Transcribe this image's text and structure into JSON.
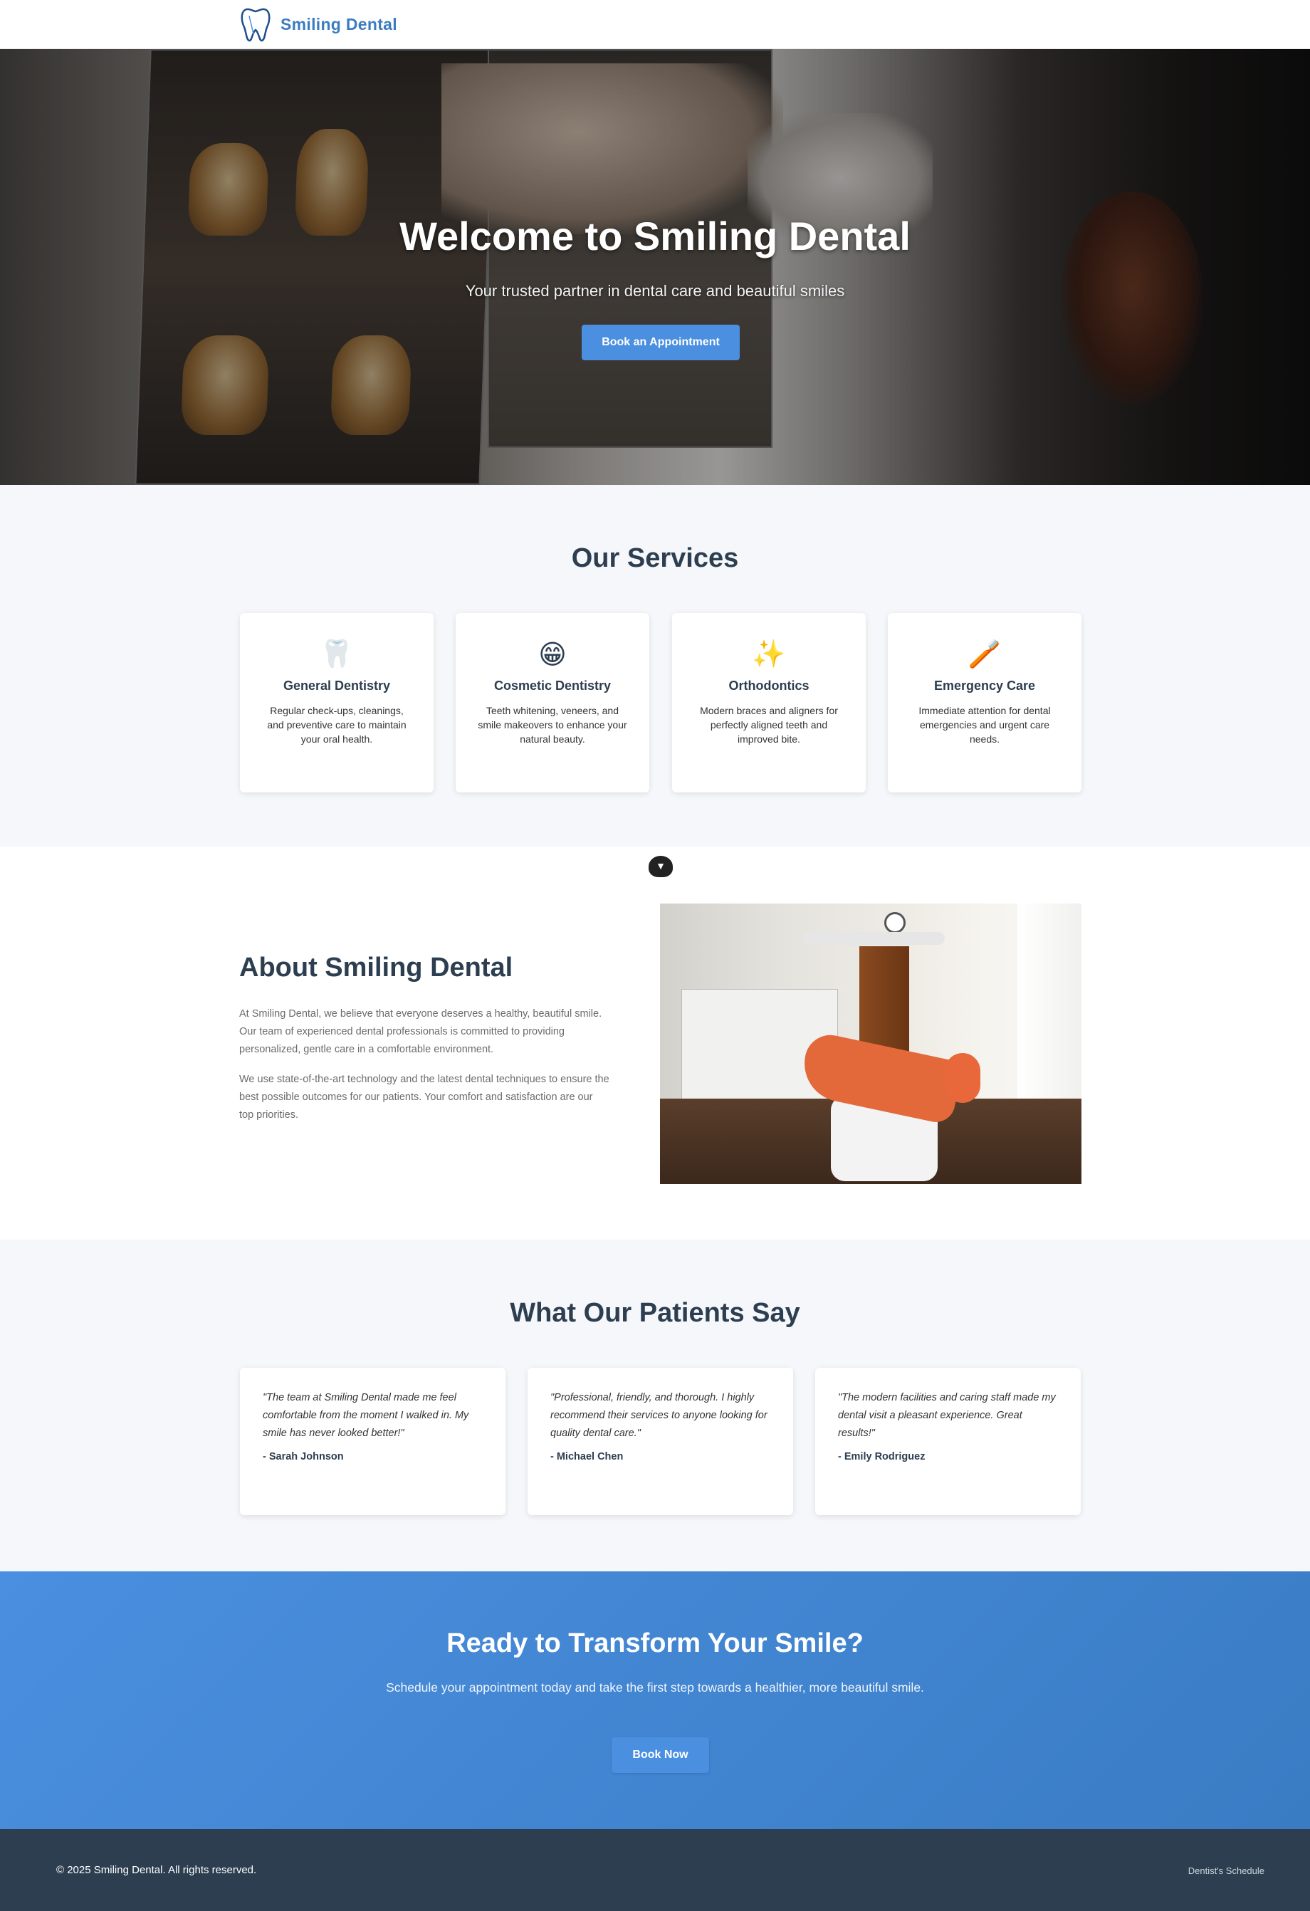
{
  "brand": {
    "name": "Smiling Dental",
    "accent": "#4a8fe0",
    "dark": "#2c3e50"
  },
  "hero": {
    "title": "Welcome to Smiling Dental",
    "subtitle": "Your trusted partner in dental care and beautiful smiles",
    "cta_label": "Book an Appointment"
  },
  "services": {
    "title": "Our Services",
    "items": [
      {
        "icon": "tooth-icon",
        "glyph": "🦷",
        "title": "General Dentistry",
        "desc": "Regular check-ups, cleanings, and preventive care to maintain your oral health."
      },
      {
        "icon": "grin-icon",
        "glyph": "😁",
        "title": "Cosmetic Dentistry",
        "desc": "Teeth whitening, veneers, and smile makeovers to enhance your natural beauty."
      },
      {
        "icon": "sparkles-icon",
        "glyph": "✨",
        "title": "Orthodontics",
        "desc": "Modern braces and aligners for perfectly aligned teeth and improved bite."
      },
      {
        "icon": "toothbrush-icon",
        "glyph": "🪥",
        "title": "Emergency Care",
        "desc": "Immediate attention for dental emergencies and urgent care needs."
      }
    ]
  },
  "about": {
    "title": "About Smiling Dental",
    "p1": "At Smiling Dental, we believe that everyone deserves a healthy, beautiful smile. Our team of experienced dental professionals is committed to providing personalized, gentle care in a comfortable environment.",
    "p2": "We use state-of-the-art technology and the latest dental techniques to ensure the best possible outcomes for our patients. Your comfort and satisfaction are our top priorities."
  },
  "testimonials": {
    "title": "What Our Patients Say",
    "items": [
      {
        "quote": "\"The team at Smiling Dental made me feel comfortable from the moment I walked in. My smile has never looked better!\"",
        "name": "- Sarah Johnson"
      },
      {
        "quote": "\"Professional, friendly, and thorough. I highly recommend their services to anyone looking for quality dental care.\"",
        "name": "- Michael Chen"
      },
      {
        "quote": "\"The modern facilities and caring staff made my dental visit a pleasant experience. Great results!\"",
        "name": "- Emily Rodriguez"
      }
    ]
  },
  "cta": {
    "title": "Ready to Transform Your Smile?",
    "subtitle": "Schedule your appointment today and take the first step towards a healthier, more beautiful smile.",
    "button": "Book Now"
  },
  "footer": {
    "copyright": "© 2025 Smiling Dental. All rights reserved.",
    "link": "Dentist's Schedule"
  }
}
